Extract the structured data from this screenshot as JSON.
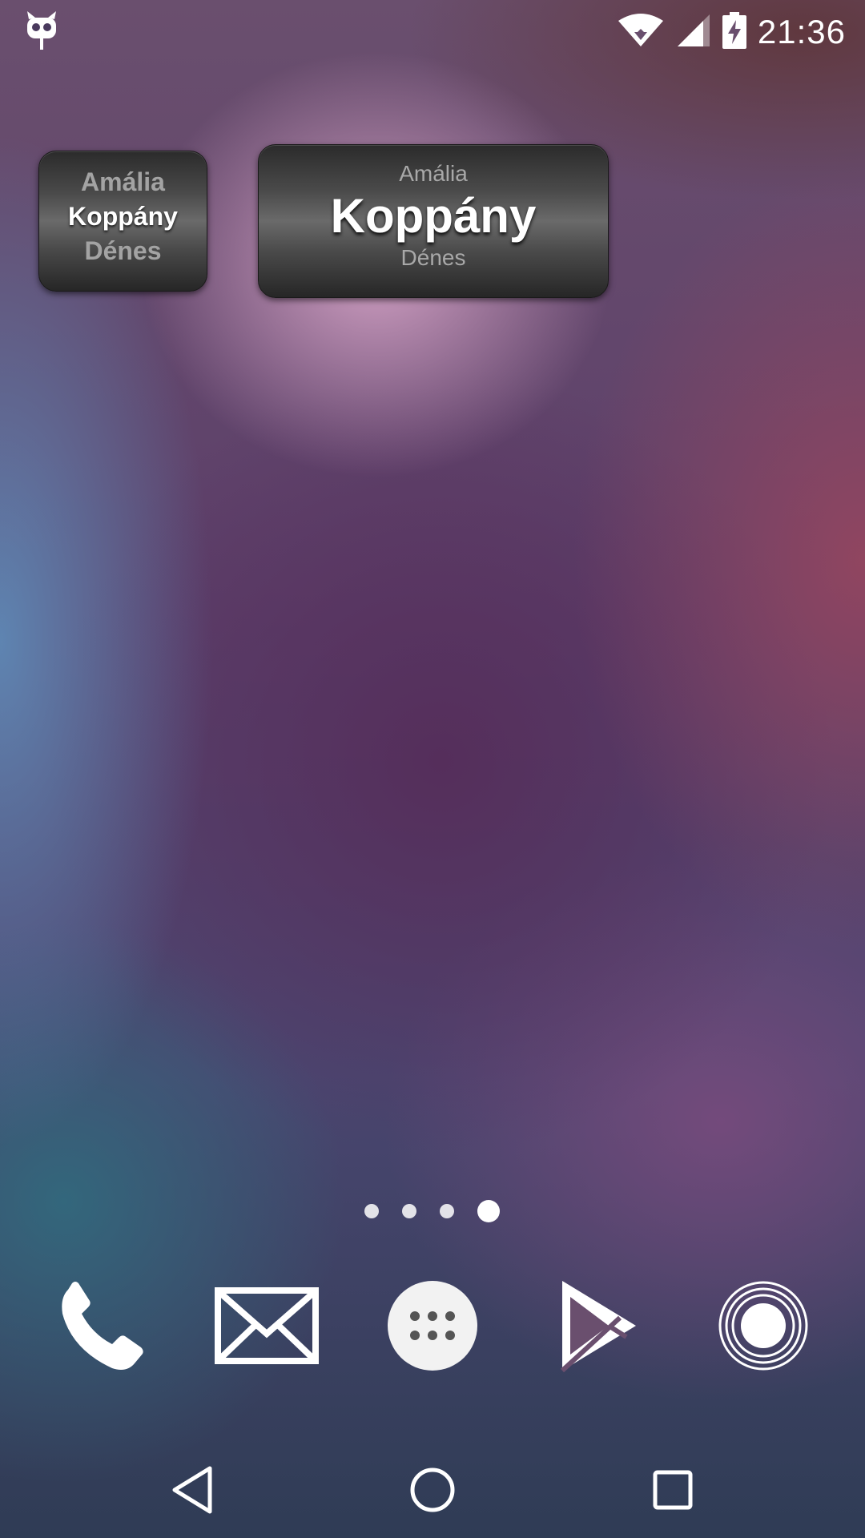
{
  "status_bar": {
    "time": "21:36",
    "icons": [
      "cyanogenmod-icon",
      "wifi-icon",
      "signal-icon",
      "battery-charging-icon"
    ]
  },
  "widgets": {
    "small": {
      "previous": "Amália",
      "current": "Koppány",
      "next": "Dénes"
    },
    "large": {
      "previous": "Amália",
      "current": "Koppány",
      "next": "Dénes"
    }
  },
  "home": {
    "page_count": 4,
    "current_page": 4
  },
  "dock": {
    "items": [
      "phone-icon",
      "email-icon",
      "app-drawer-icon",
      "play-store-icon",
      "camera-icon"
    ]
  },
  "nav_bar": {
    "items": [
      "back-icon",
      "home-icon",
      "recents-icon"
    ]
  },
  "colors": {
    "icon": "#ffffff",
    "widget_dim_text": "#a3a3a3"
  }
}
